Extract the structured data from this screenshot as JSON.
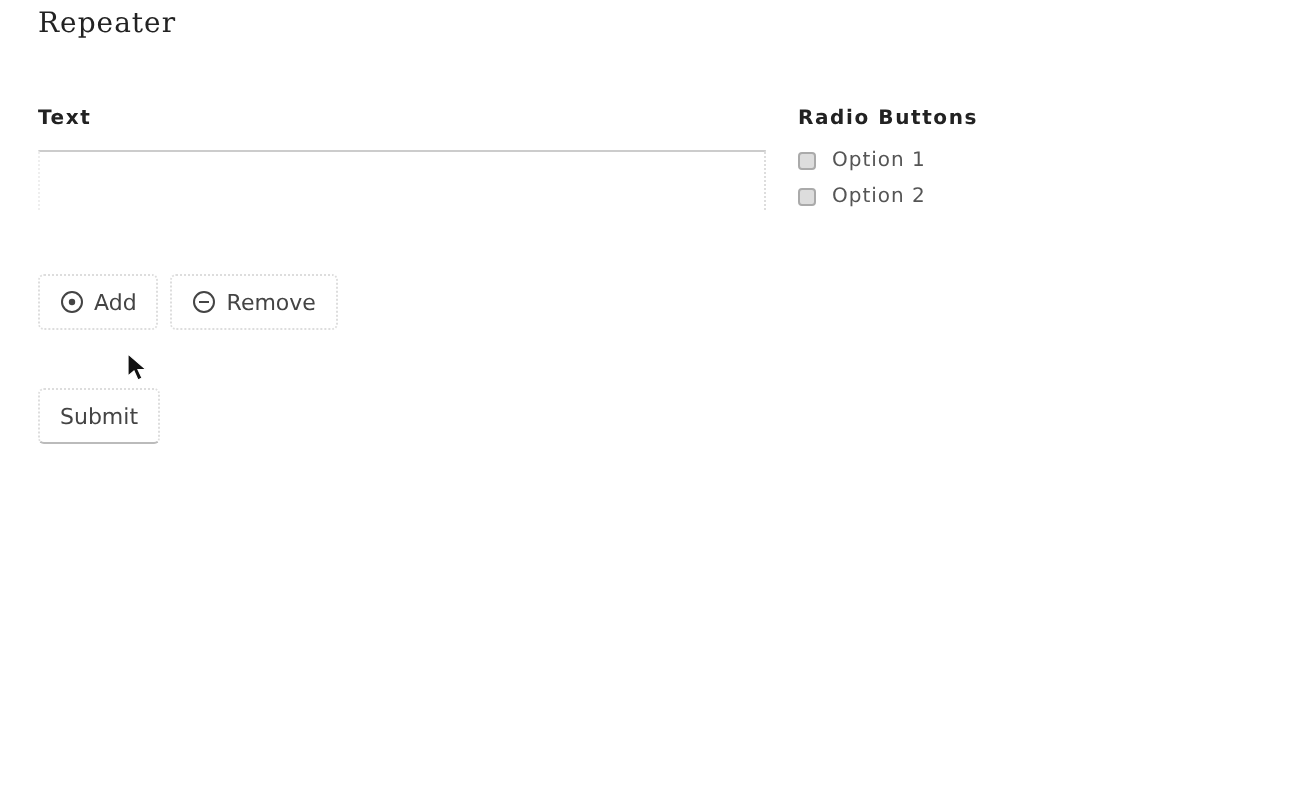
{
  "title": "Repeater",
  "text_field": {
    "label": "Text"
  },
  "radio_group": {
    "label": "Radio Buttons",
    "options": [
      {
        "label": "Option 1",
        "selected": false
      },
      {
        "label": "Option 2",
        "selected": false
      }
    ]
  },
  "actions": [
    {
      "label": "Add",
      "kind": "add"
    },
    {
      "label": "Remove",
      "kind": "remove"
    }
  ],
  "submit": "Submit"
}
